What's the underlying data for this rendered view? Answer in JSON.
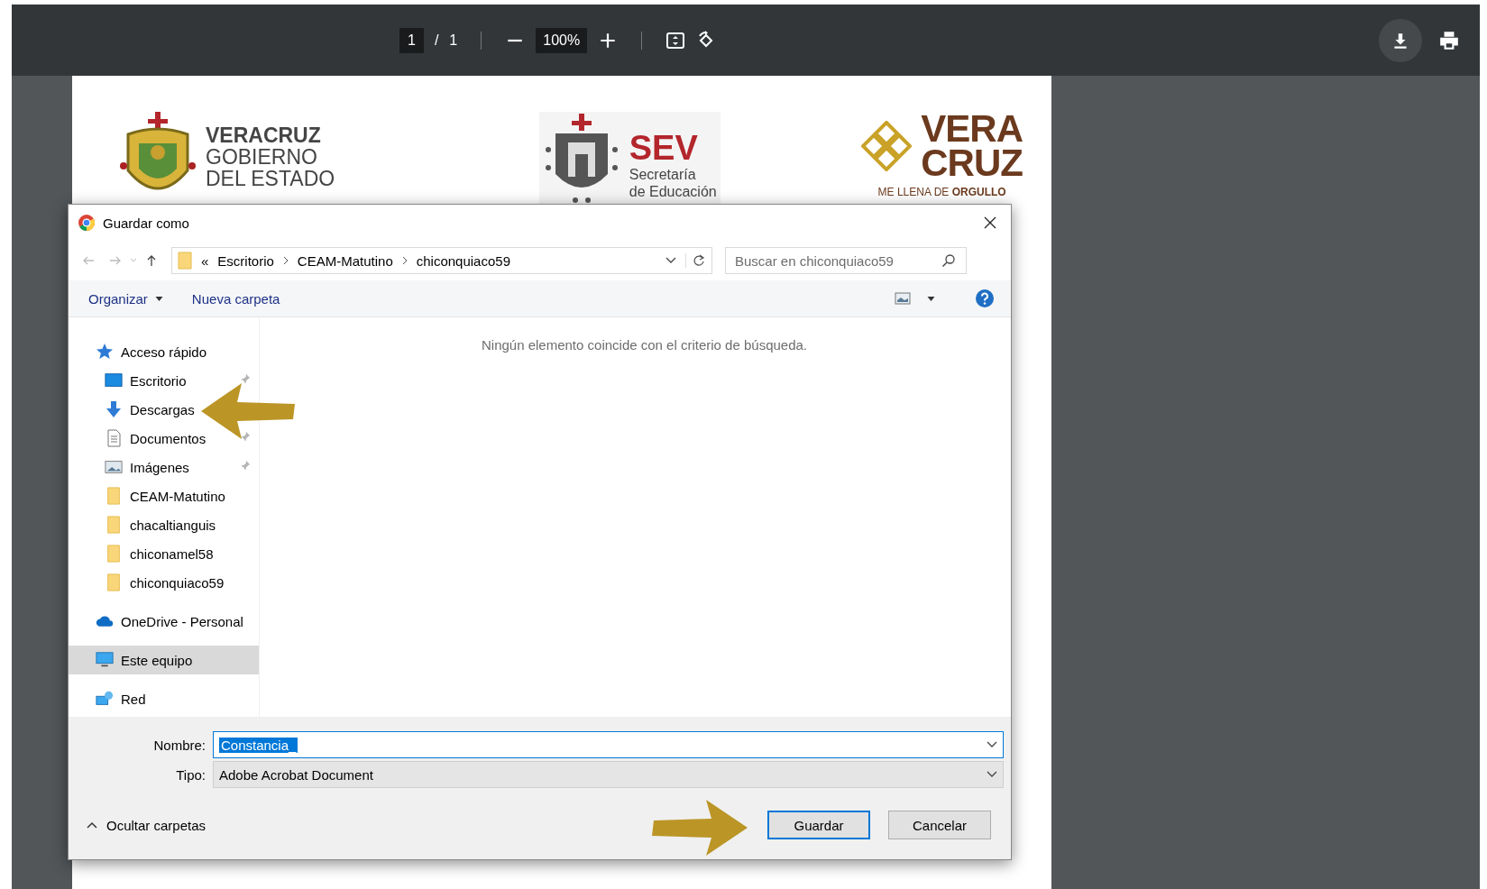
{
  "viewer_toolbar": {
    "page_current": "1",
    "page_separator": "/",
    "page_total": "1",
    "zoom": "100%"
  },
  "document": {
    "logos": [
      {
        "kind": "gobierno",
        "lines": [
          "VERACRUZ",
          "GOBIERNO",
          "DEL ESTADO"
        ]
      },
      {
        "kind": "sev",
        "title": "SEV",
        "lines": [
          "Secretaría",
          "de Educación"
        ]
      },
      {
        "kind": "veracruz",
        "lines": [
          "VERA",
          "CRUZ"
        ],
        "slogan": "ME LLENA DE **ORGULLO**"
      }
    ]
  },
  "dialog": {
    "title": "Guardar como",
    "breadcrumb_prefix": "«",
    "path": [
      "Escritorio",
      "CEAM-Matutino",
      "chiconquiaco59"
    ],
    "search": {
      "placeholder": "Buscar en chiconquiaco59"
    },
    "toolbar": {
      "organize": "Organizar",
      "new_folder": "Nueva carpeta"
    },
    "nav": [
      {
        "label": "Acceso rápido",
        "kind": "star",
        "selected": false,
        "children": [
          {
            "label": "Escritorio",
            "kind": "desktop",
            "selected": false,
            "pinned": true
          },
          {
            "label": "Descargas",
            "kind": "download",
            "selected": false
          },
          {
            "label": "Documentos",
            "kind": "document",
            "selected": false,
            "pinned": true
          },
          {
            "label": "Imágenes",
            "kind": "pictures",
            "selected": false,
            "pinned": true
          },
          {
            "label": "CEAM-Matutino",
            "kind": "folder",
            "selected": false,
            "pinned": false
          },
          {
            "label": "chacaltianguis",
            "kind": "folder",
            "selected": false,
            "pinned": false
          },
          {
            "label": "chiconamel58",
            "kind": "folder",
            "selected": false,
            "pinned": false
          },
          {
            "label": "chiconquiaco59",
            "kind": "folder",
            "selected": false,
            "pinned": false
          }
        ]
      },
      {
        "label": "OneDrive - Personal",
        "kind": "cloud",
        "selected": false
      },
      {
        "label": "Este equipo",
        "kind": "computer",
        "selected": true
      },
      {
        "label": "Red",
        "kind": "network",
        "selected": false
      }
    ],
    "empty_message": "Ningún elemento coincide con el criterio de búsqueda.",
    "filename_label": "Nombre:",
    "filename": "Constancia_",
    "filename_selected": true,
    "type_label": "Tipo:",
    "type": "Adobe Acrobat Document",
    "hide_folders": "Ocultar carpetas",
    "buttons": [
      {
        "label": "Guardar",
        "kind": "default"
      },
      {
        "label": "Cancelar",
        "kind": "normal"
      }
    ]
  }
}
